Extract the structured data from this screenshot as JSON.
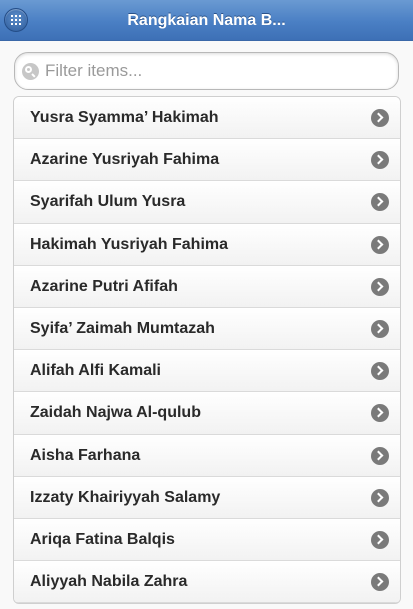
{
  "header": {
    "title": "Rangkaian Nama B..."
  },
  "search": {
    "placeholder": "Filter items...",
    "value": ""
  },
  "list": {
    "items": [
      {
        "label": "Yusra Syamma’ Hakimah"
      },
      {
        "label": "Azarine Yusriyah Fahima"
      },
      {
        "label": "Syarifah Ulum Yusra"
      },
      {
        "label": "Hakimah Yusriyah Fahima"
      },
      {
        "label": "Azarine Putri Afifah"
      },
      {
        "label": "Syifa’ Zaimah Mumtazah"
      },
      {
        "label": "Alifah Alfi Kamali"
      },
      {
        "label": "Zaidah Najwa Al-qulub"
      },
      {
        "label": "Aisha Farhana"
      },
      {
        "label": "Izzaty Khairiyyah Salamy"
      },
      {
        "label": "Ariqa Fatina Balqis"
      },
      {
        "label": "Aliyyah Nabila Zahra"
      }
    ]
  }
}
